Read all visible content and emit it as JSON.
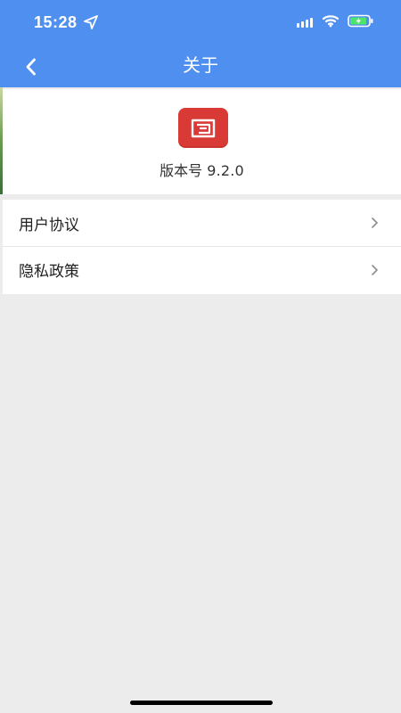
{
  "status_bar": {
    "time": "15:28",
    "icons": {
      "location": "location-arrow-icon",
      "signal": "cellular-signal-icon",
      "wifi": "wifi-icon",
      "battery": "battery-charging-icon"
    }
  },
  "header": {
    "title": "关于",
    "back_icon": "chevron-left-icon"
  },
  "about": {
    "logo_icon": "app-logo-icon",
    "version_label": "版本号",
    "version_value": "9.2.0"
  },
  "menu": {
    "items": [
      {
        "label": "用户协议",
        "icon": "chevron-right-icon"
      },
      {
        "label": "隐私政策",
        "icon": "chevron-right-icon"
      }
    ]
  },
  "colors": {
    "header_bg": "#4f8ff0",
    "page_bg": "#ececec",
    "card_bg": "#ffffff",
    "logo_bg": "#d93a35",
    "text_primary": "#1f1f1f",
    "chevron": "#8f8f8f"
  }
}
